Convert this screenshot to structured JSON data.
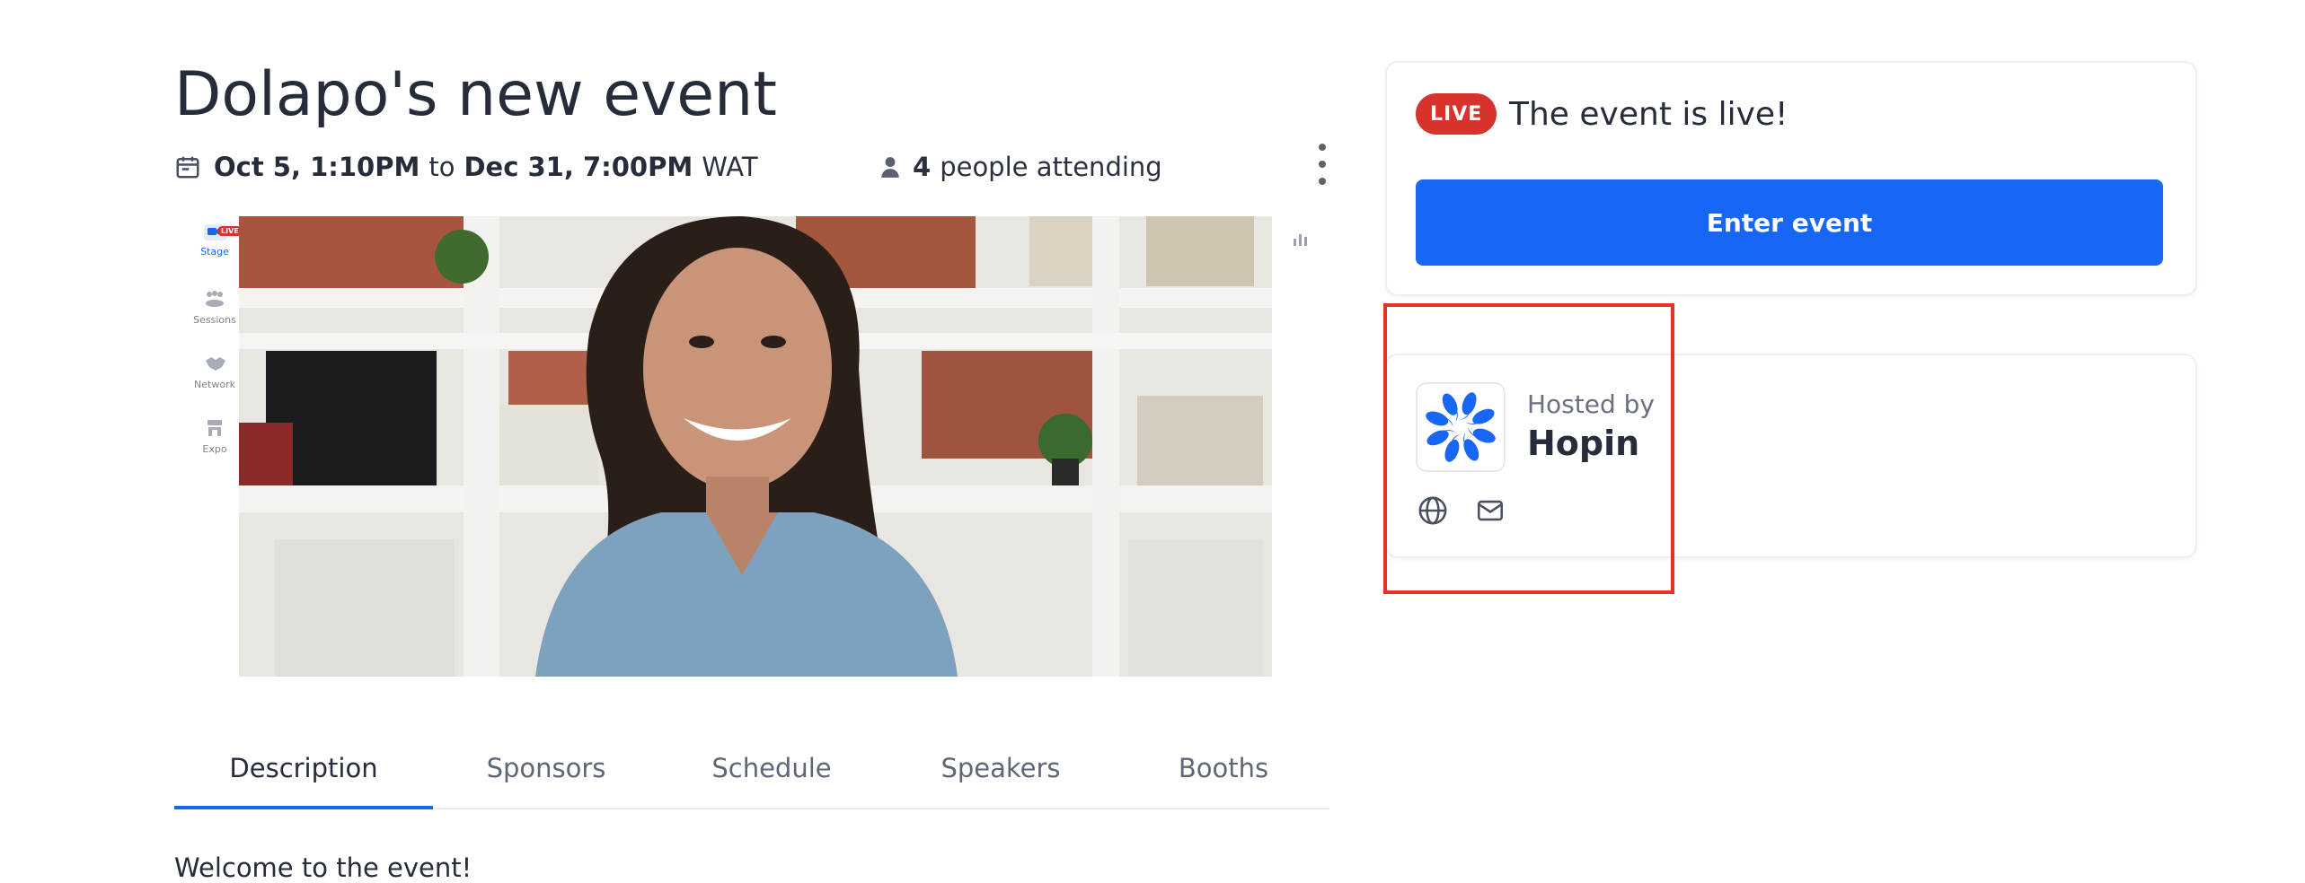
{
  "event": {
    "title": "Dolapo's new event",
    "start": "Oct 5, 1:10PM",
    "to_word": "to",
    "end": "Dec 31, 7:00PM",
    "timezone": "WAT",
    "attending_count": "4",
    "attending_label": "people attending"
  },
  "preview": {
    "nav": [
      {
        "label": "Stage",
        "badge": "LIVE",
        "active": true
      },
      {
        "label": "Sessions"
      },
      {
        "label": "Network"
      },
      {
        "label": "Expo"
      }
    ]
  },
  "tabs": [
    {
      "label": "Description",
      "active": true
    },
    {
      "label": "Sponsors"
    },
    {
      "label": "Schedule"
    },
    {
      "label": "Speakers"
    },
    {
      "label": "Booths"
    }
  ],
  "description": {
    "text": "Welcome to the event!"
  },
  "live_card": {
    "badge": "LIVE",
    "status_text": "The event is live!",
    "enter_button": "Enter event"
  },
  "host_card": {
    "hosted_by_label": "Hosted by",
    "host_name": "Hopin",
    "links": [
      "globe-icon",
      "mail-icon"
    ]
  },
  "colors": {
    "accent": "#1766f5",
    "live": "#d8322c",
    "highlight": "#e7311f"
  }
}
